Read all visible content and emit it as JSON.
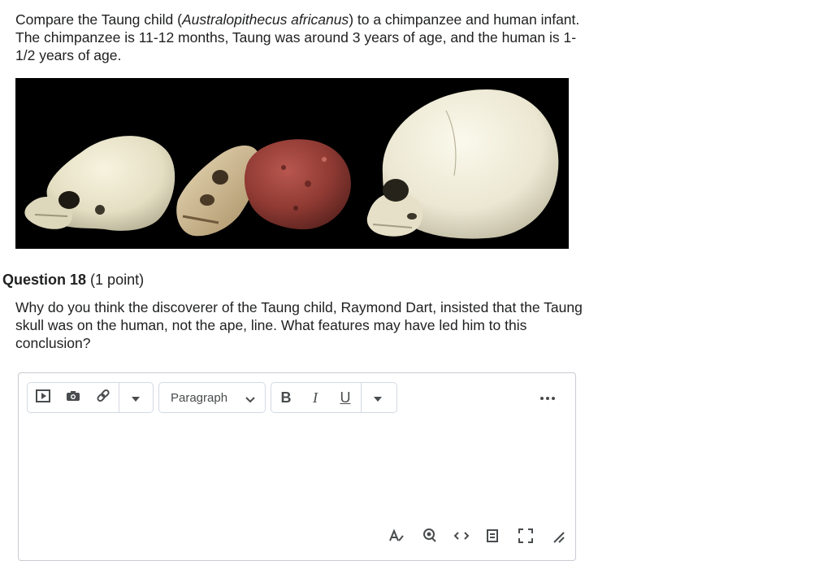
{
  "intro": {
    "text_before": "Compare the Taung child (",
    "species": "Australopithecus africanus",
    "text_after": ") to a chimpanzee and human infant.  The chimpanzee is 11-12 months, Taung was around 3 years of age, and the human is 1-1/2 years of age."
  },
  "question": {
    "number": "Question 18",
    "points": "(1 point)",
    "text": "Why do you think the discoverer of the Taung child, Raymond Dart, insisted that the Taung skull was on the human, not the ape, line.  What features may have led him to this conclusion?"
  },
  "editor": {
    "format_value": "Paragraph",
    "bold_label": "B",
    "italic_label": "I",
    "underline_label": "U",
    "more_label": "…"
  },
  "icons": {
    "insert_media": "play-icon",
    "insert_image": "camera-icon",
    "insert_link": "link-icon",
    "insert_menu": "caret-down-icon",
    "format_menu": "chevron-down-icon",
    "text_menu": "caret-down-icon",
    "more": "ellipsis-icon"
  },
  "colors": {
    "text": "#202122",
    "toolbar_border": "#d3d9e3",
    "editor_border": "#c9cbd1",
    "icon": "#494c4e"
  }
}
